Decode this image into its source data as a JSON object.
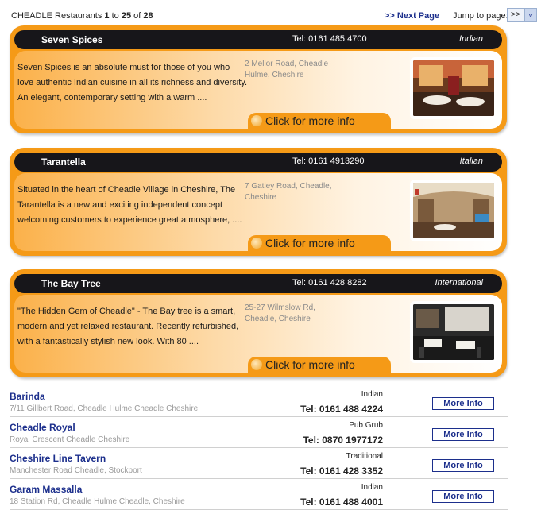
{
  "topbar": {
    "city": "CHEADLE Restaurants",
    "range_start": "1",
    "to": "to",
    "range_end": "25",
    "of": "of",
    "total": "28",
    "next_page": ">> Next Page",
    "jump_label": "Jump to page:",
    "jump_value": ">>",
    "jump_arrow": "v"
  },
  "featured": [
    {
      "name": "Seven Spices",
      "tel": "Tel: 0161 485 4700",
      "cuisine": "Indian",
      "description": "Seven Spices is an absolute must for those of you who love authentic Indian cuisine in all its richness and diversity. An elegant, contemporary setting with a warm ....",
      "address": "2 Mellor Road, Cheadle Hulme, Cheshire",
      "more": "Click for more info"
    },
    {
      "name": "Tarantella",
      "tel": "Tel: 0161 4913290",
      "cuisine": "Italian",
      "description": "Situated in the heart of Cheadle Village in Cheshire, The Tarantella is a new and exciting independent concept welcoming customers to experience great atmosphere, ....",
      "address": "7 Gatley Road, Cheadle, Cheshire",
      "more": "Click for more info"
    },
    {
      "name": "The Bay Tree",
      "tel": "Tel: 0161 428 8282",
      "cuisine": "International",
      "description": "\"The Hidden Gem of Cheadle\" - The Bay tree is a smart, modern and yet relaxed restaurant. Recently refurbished, with a fantastically stylish new look. With 80 ....",
      "address": "25-27 Wilmslow Rd, Cheadle, Cheshire",
      "more": "Click for more info"
    }
  ],
  "listings": [
    {
      "name": "Barinda",
      "address": "7/11 Gillbert Road, Cheadle Hulme Cheadle Cheshire",
      "category": "Indian",
      "tel": "Tel: 0161 488 4224",
      "button": "More Info"
    },
    {
      "name": "Cheadle Royal",
      "address": "Royal Crescent Cheadle Cheshire",
      "category": "Pub Grub",
      "tel": "Tel: 0870 1977172",
      "button": "More Info"
    },
    {
      "name": "Cheshire Line Tavern",
      "address": "Manchester Road Cheadle, Stockport",
      "category": "Traditional",
      "tel": "Tel: 0161 428 3352",
      "button": "More Info"
    },
    {
      "name": "Garam Massalla",
      "address": "18 Station Rd, Cheadle Hulme Cheadle, Cheshire",
      "category": "Indian",
      "tel": "Tel: 0161 488 4001",
      "button": "More Info"
    }
  ],
  "colors": {
    "card_orange": "#f59a17",
    "header_dark": "#17161a",
    "link_blue": "#1c2f8c"
  }
}
